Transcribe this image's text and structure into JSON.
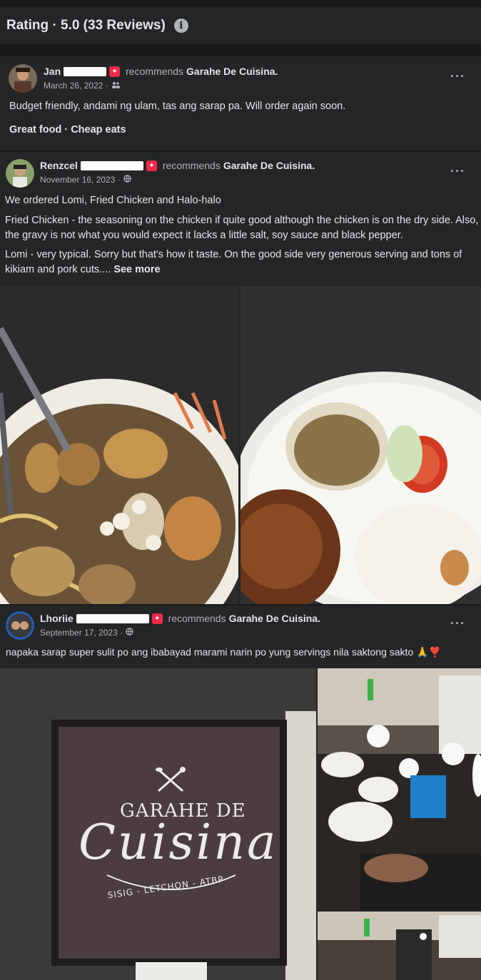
{
  "header": {
    "title": "Rating · 5.0 (33 Reviews)",
    "info_icon": "info-icon"
  },
  "reviews": [
    {
      "author": "Jan",
      "recommends": "recommends",
      "page": "Garahe De Cuisina.",
      "date": "March 26, 2022 ·",
      "audience_icon": "friends-icon",
      "text": "Budget friendly, andami ng ulam, tas ang sarap pa. Will order again soon.",
      "tags": "Great food · Cheap eats",
      "more": "···"
    },
    {
      "author": "Renzcel",
      "recommends": "recommends",
      "page": "Garahe De Cuisina.",
      "date": "November 16, 2023 ·",
      "audience_icon": "globe-icon",
      "p1": "We ordered Lomi, Fried Chicken and Halo-halo",
      "p2": "Fried Chicken - the seasoning on the chicken if quite good although the chicken is on the dry side. Also, the gravy is not what you would expect it lacks a little salt, soy sauce and black pepper.",
      "p3": "Lomi - very typical. Sorry but that's how it taste. On the good side very generous serving and tons of kikiam and pork cuts....",
      "see_more": "See more",
      "more": "···"
    },
    {
      "author": "Lhoriie",
      "recommends": "recommends",
      "page": "Garahe De Cuisina.",
      "date": "September 17, 2023 ·",
      "audience_icon": "globe-icon",
      "text": "napaka sarap super sulit po ang ibabayad marami narin po yung servings nila saktong sakto 🙏❣️",
      "more": "···"
    }
  ],
  "sign": {
    "line1": "GARAHE DE",
    "line2": "Cuisina",
    "line3": "SISIG - LETCHON - ATBP"
  },
  "colors": {
    "background": "#18191a",
    "card": "#242526",
    "badge": "#f02849",
    "text": "#e4e6eb",
    "muted": "#b0b3b8"
  }
}
